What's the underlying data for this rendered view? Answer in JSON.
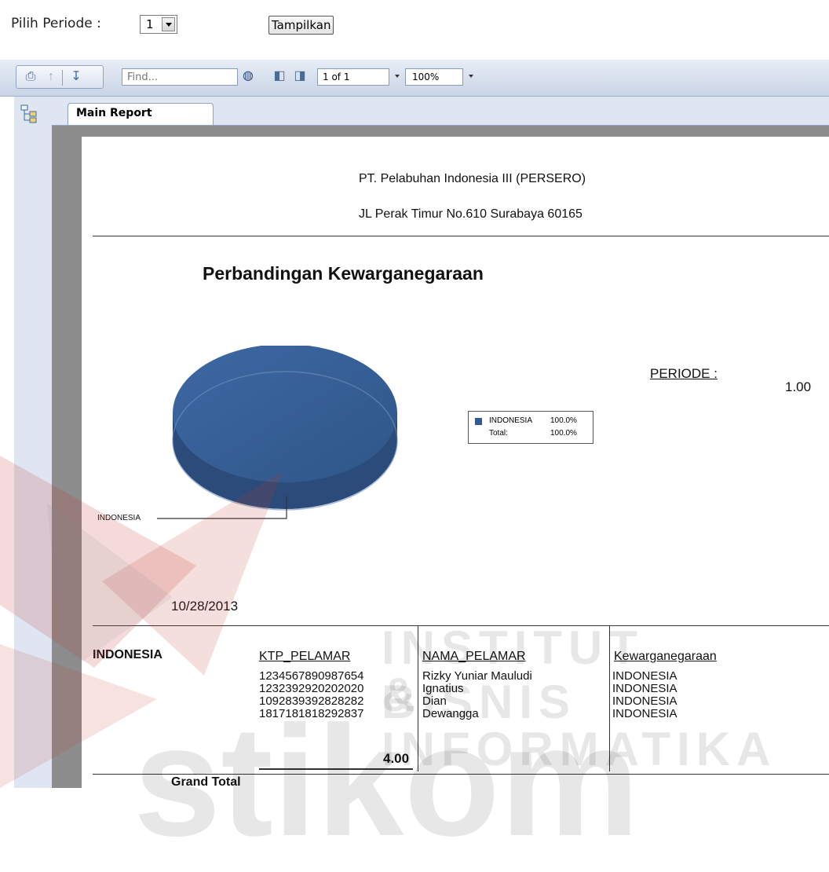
{
  "controls": {
    "periode_label": "Pilih Periode :",
    "periode_value": "1",
    "show_button": "Tampilkan"
  },
  "toolbar": {
    "find_placeholder": "Find...",
    "page_indicator": "1 of 1",
    "zoom": "100%"
  },
  "tabs": {
    "main": "Main Report"
  },
  "report": {
    "company": "PT. Pelabuhan Indonesia III (PERSERO)",
    "address": "JL Perak Timur No.610 Surabaya 60165",
    "chart_title": "Perbandingan Kewarganegaraan",
    "periode_label": "PERIODE :",
    "periode_value": "1.00",
    "date": "10/28/2013",
    "group_label": "INDONESIA",
    "columns": [
      "KTP_PELAMAR",
      "NAMA_PELAMAR",
      "Kewarganegaraan"
    ],
    "rows": [
      {
        "ktp": "1234567890987654",
        "nama": "Rizky Yuniar Mauludi",
        "warga": "INDONESIA"
      },
      {
        "ktp": "1232392920202020",
        "nama": "Ignatius",
        "warga": "INDONESIA"
      },
      {
        "ktp": "1092839392828282",
        "nama": "Dian",
        "warga": "INDONESIA"
      },
      {
        "ktp": "1817181818292837",
        "nama": "Dewangga",
        "warga": "INDONESIA"
      }
    ],
    "count": "4.00",
    "grand_total": "Grand Total"
  },
  "chart_data": {
    "type": "pie",
    "categories": [
      "INDONESIA"
    ],
    "values": [
      100.0
    ],
    "slice_label": "INDONESIA",
    "legend": [
      {
        "label": "INDONESIA",
        "value": "100.0%"
      },
      {
        "label": "Total:",
        "value": "100.0%"
      }
    ],
    "color": "#3a6399"
  },
  "watermark": {
    "line1": "INSTITUT BISNIS",
    "line2": "& INFORMATIKA",
    "line3": "stikom"
  }
}
